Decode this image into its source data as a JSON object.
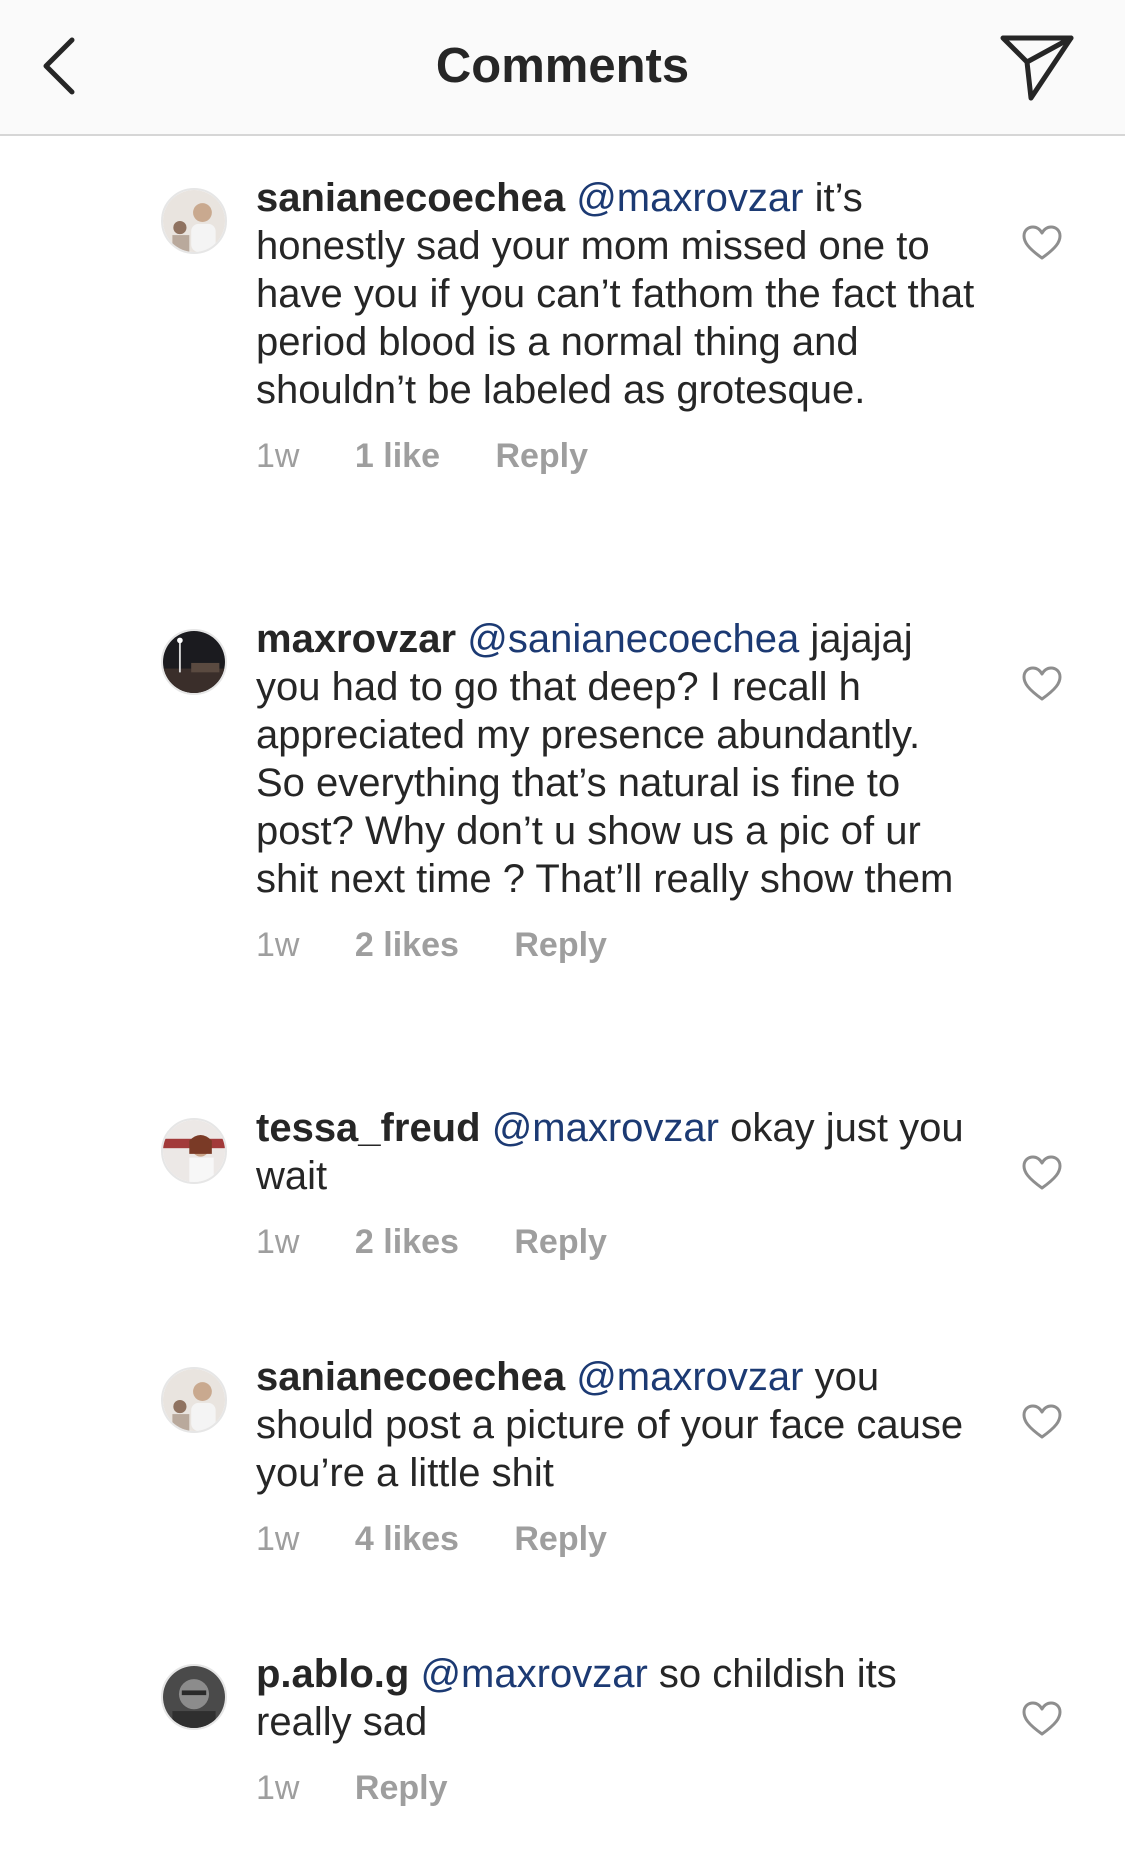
{
  "header": {
    "title": "Comments",
    "back_icon": "chevron-left-icon",
    "send_icon": "paper-plane-icon"
  },
  "comments": [
    {
      "username": "sanianecoechea",
      "mention": "@maxrovzar",
      "text": " it’s honestly sad your mom missed one to have you if you can’t fathom the fact that period blood is a normal thing and shouldn’t be labeled as grotesque.",
      "time": "1w",
      "likes": "1 like",
      "reply": "Reply"
    },
    {
      "username": "maxrovzar",
      "mention": "@sanianecoechea",
      "text": " jajajaj you had to go that deep? I recall h appreciated my presence abundantly. So everything that’s natural is fine to post? Why don’t u show us a pic of ur shit next time ? That’ll really show them",
      "time": "1w",
      "likes": "2 likes",
      "reply": "Reply"
    },
    {
      "username": "tessa_freud",
      "mention": "@maxrovzar",
      "text": " okay just you wait",
      "time": "1w",
      "likes": "2 likes",
      "reply": "Reply"
    },
    {
      "username": "sanianecoechea",
      "mention": "@maxrovzar",
      "text": " you should post a picture of your face cause you’re a little shit",
      "time": "1w",
      "likes": "4 likes",
      "reply": "Reply"
    },
    {
      "username": "p.ablo.g",
      "mention": "@maxrovzar",
      "text": " so childish its really sad",
      "time": "1w",
      "reply": "Reply"
    }
  ]
}
